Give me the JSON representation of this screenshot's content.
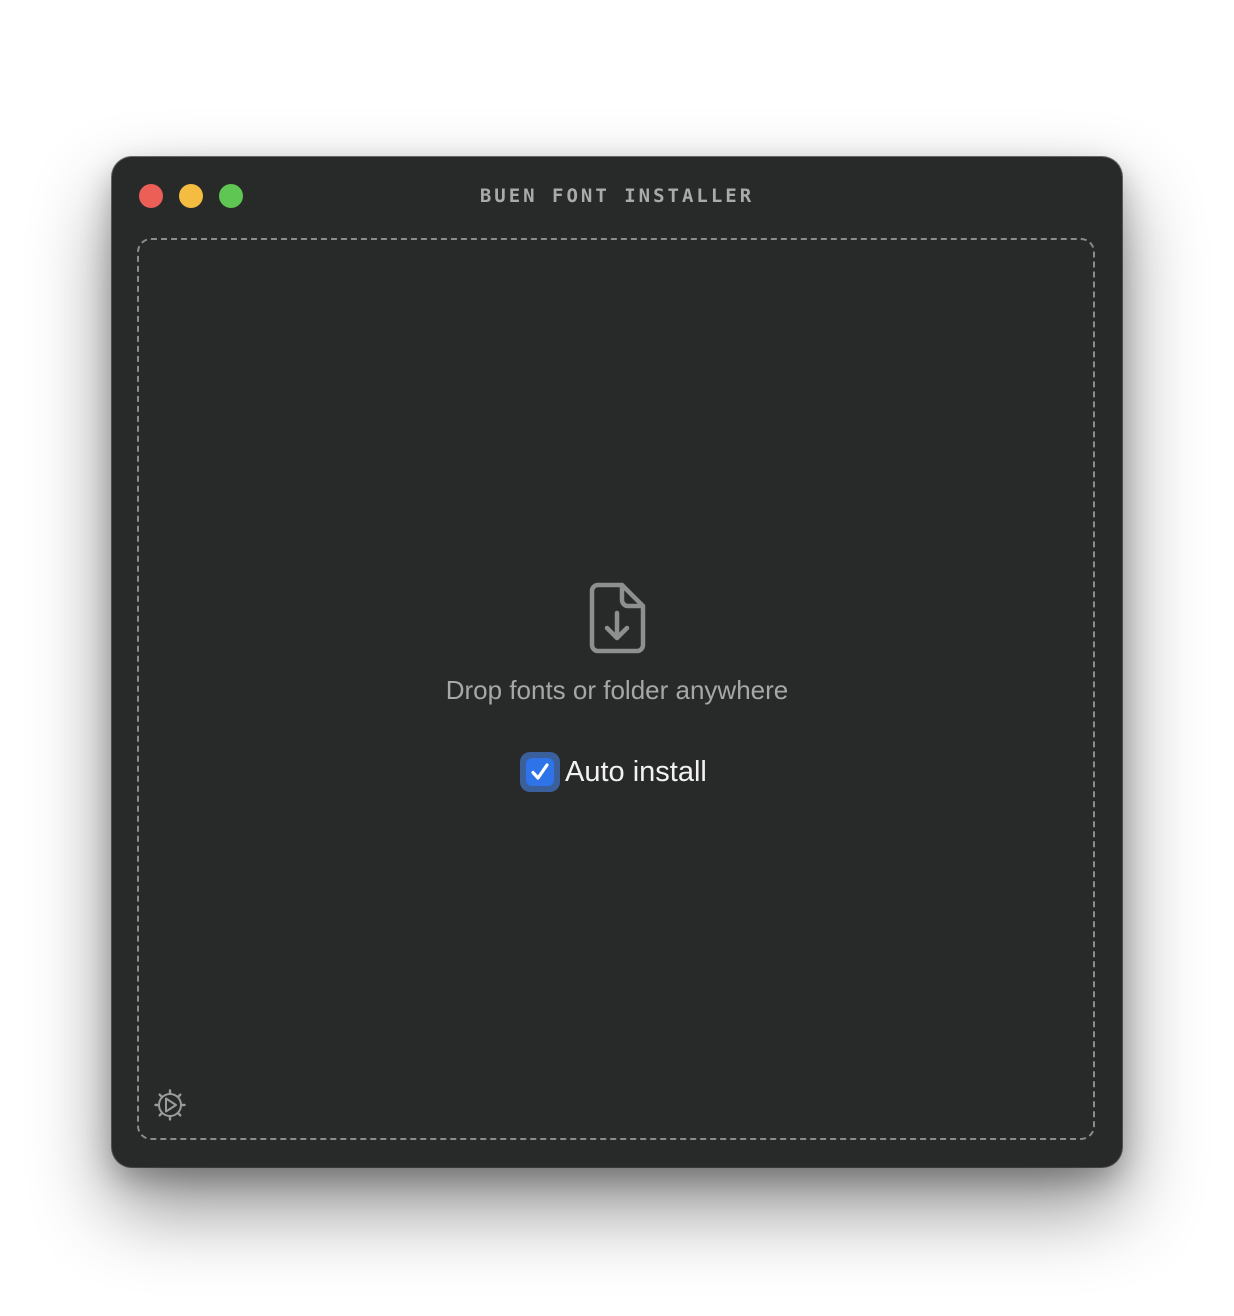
{
  "window": {
    "title": "BUEN FONT INSTALLER",
    "traffic_lights": {
      "close_color": "#ec5f57",
      "minimize_color": "#f4bc41",
      "zoom_color": "#5fc553"
    }
  },
  "dropzone": {
    "icon": "document-download-icon",
    "message": "Drop fonts or folder anywhere"
  },
  "auto_install": {
    "label": "Auto install",
    "checked": true
  },
  "footer": {
    "settings_icon": "gear-icon"
  }
}
